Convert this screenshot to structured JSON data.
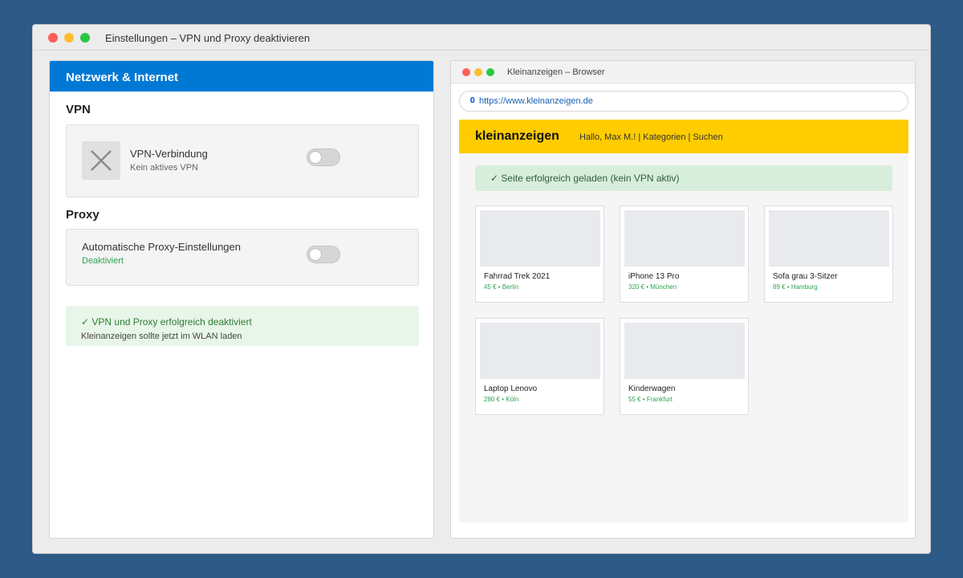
{
  "window": {
    "title": "Einstellungen – VPN und Proxy deaktivieren"
  },
  "settings": {
    "header": "Netzwerk & Internet",
    "vpn": {
      "section_title": "VPN",
      "connection_title": "VPN-Verbindung",
      "connection_status": "Kein aktives VPN",
      "toggle_on": false
    },
    "proxy": {
      "section_title": "Proxy",
      "auto_title": "Automatische Proxy-Einstellungen",
      "auto_status": "Deaktiviert",
      "toggle_on": false
    },
    "success": {
      "message": "✓ VPN und Proxy erfolgreich deaktiviert",
      "sub": "Kleinanzeigen sollte jetzt im WLAN laden"
    }
  },
  "browser": {
    "title": "Kleinanzeigen – Browser",
    "url": "https://www.kleinanzeigen.de",
    "url_icon": "lock-icon",
    "site": {
      "logo": "kleinanzeigen",
      "nav": "Hallo, Max M.! | Kategorien | Suchen",
      "banner": "✓ Seite erfolgreich geladen (kein VPN aktiv)",
      "listings": [
        {
          "name": "Fahrrad Trek 2021",
          "meta": "45 € • Berlin"
        },
        {
          "name": "iPhone 13 Pro",
          "meta": "320 € • München"
        },
        {
          "name": "Sofa grau 3-Sitzer",
          "meta": "89 € • Hamburg"
        },
        {
          "name": "Laptop Lenovo",
          "meta": "280 € • Köln"
        },
        {
          "name": "Kinderwagen",
          "meta": "55 € • Frankfurt"
        }
      ]
    }
  },
  "colors": {
    "desktop": "#2d5a87",
    "settings_header": "#0078d4",
    "site_header": "#ffcc00",
    "success_text": "#2e7d32",
    "price_text": "#2ea44f"
  }
}
